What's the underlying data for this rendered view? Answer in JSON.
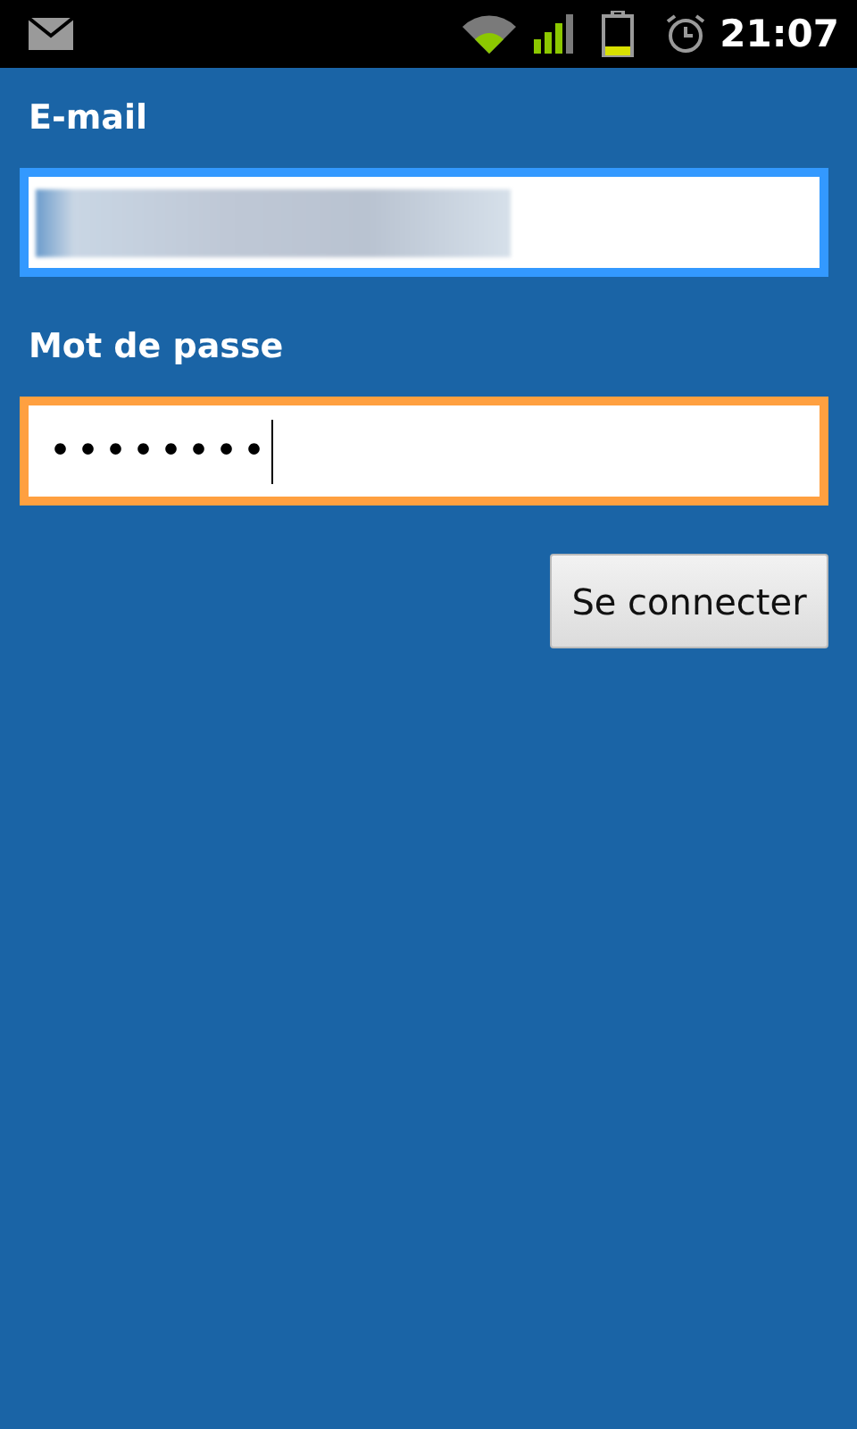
{
  "status_bar": {
    "time": "21:07"
  },
  "fields": [
    {
      "label": "E-mail",
      "kind": "text",
      "redacted": true,
      "focused": false
    },
    {
      "label": "Mot de passe",
      "kind": "password",
      "value": "••••••••",
      "focused": true
    }
  ],
  "buttons": [
    "Se connecter"
  ]
}
